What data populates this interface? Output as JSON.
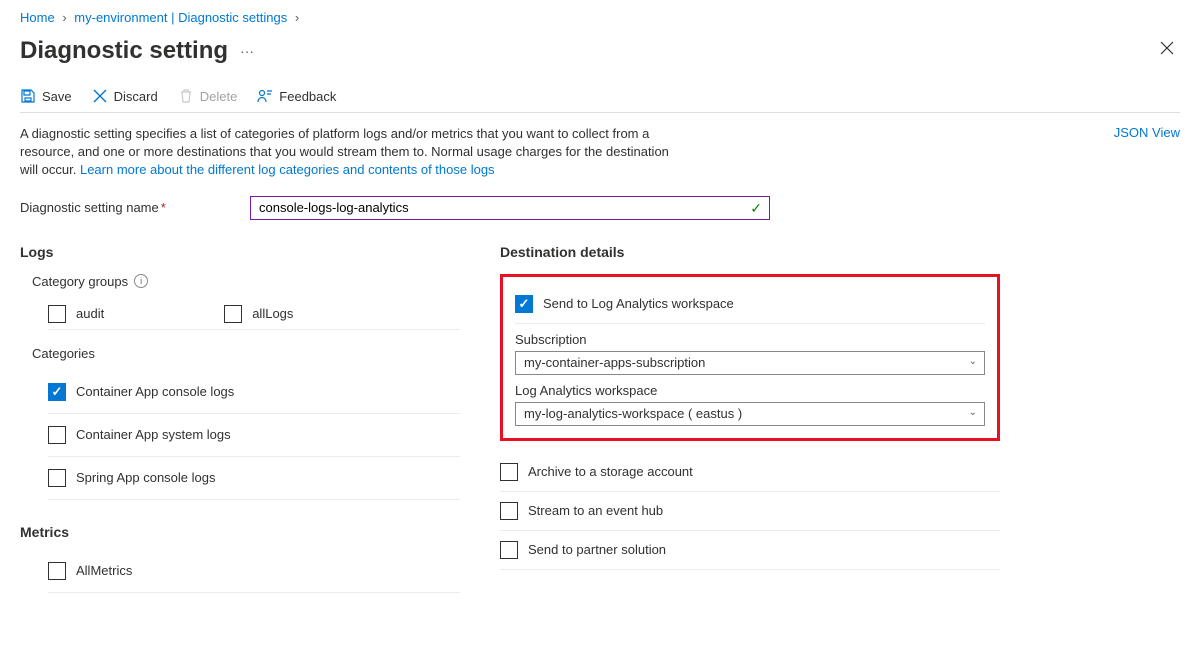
{
  "breadcrumb": {
    "home": "Home",
    "path": "my-environment | Diagnostic settings"
  },
  "page": {
    "title": "Diagnostic setting",
    "jsonView": "JSON View"
  },
  "toolbar": {
    "save": "Save",
    "discard": "Discard",
    "delete": "Delete",
    "feedback": "Feedback"
  },
  "description": {
    "text1": "A diagnostic setting specifies a list of categories of platform logs and/or metrics that you want to collect from a resource, and one or more destinations that you would stream them to. Normal usage charges for the destination will occur. ",
    "link": "Learn more about the different log categories and contents of those logs"
  },
  "nameField": {
    "label": "Diagnostic setting name",
    "value": "console-logs-log-analytics"
  },
  "logs": {
    "heading": "Logs",
    "categoryGroups": "Category groups",
    "audit": "audit",
    "allLogs": "allLogs",
    "categories": "Categories",
    "cat1": "Container App console logs",
    "cat2": "Container App system logs",
    "cat3": "Spring App console logs"
  },
  "metrics": {
    "heading": "Metrics",
    "allMetrics": "AllMetrics"
  },
  "destination": {
    "heading": "Destination details",
    "logAnalytics": "Send to Log Analytics workspace",
    "subscriptionLabel": "Subscription",
    "subscriptionValue": "my-container-apps-subscription",
    "workspaceLabel": "Log Analytics workspace",
    "workspaceValue": "my-log-analytics-workspace ( eastus )",
    "storage": "Archive to a storage account",
    "eventhub": "Stream to an event hub",
    "partner": "Send to partner solution"
  }
}
